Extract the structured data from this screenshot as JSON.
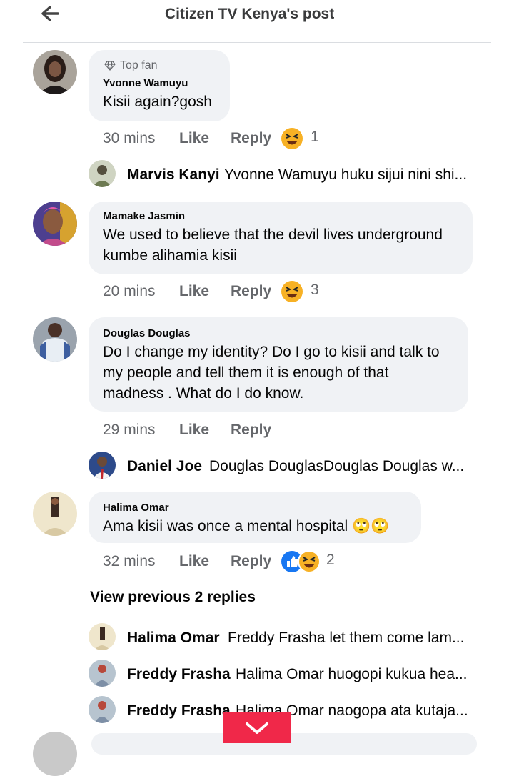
{
  "header": {
    "title": "Citizen TV Kenya's post"
  },
  "comments": [
    {
      "badge": "Top fan",
      "author": "Yvonne Wamuyu",
      "lines": [
        "Kisii again?gosh"
      ],
      "time": "30 mins",
      "like": "Like",
      "reply": "Reply",
      "reactions": [
        "haha-icon"
      ],
      "count": "1"
    },
    {
      "author": "Mamake Jasmin",
      "lines": [
        "We used to believe that the devil lives underground",
        "kumbe alihamia kisii"
      ],
      "time": "20 mins",
      "like": "Like",
      "reply": "Reply",
      "reactions": [
        "haha-icon"
      ],
      "count": "3"
    },
    {
      "author": "Douglas Douglas",
      "lines": [
        "Do I change my identity? Do I go to kisii and talk to",
        "my people and tell them it is enough of that",
        "madness . What do I do know."
      ],
      "time": "29 mins",
      "like": "Like",
      "reply": "Reply"
    },
    {
      "author": "Halima Omar",
      "lines": [
        "Ama kisii was once a mental hospital 🙄🙄"
      ],
      "time": "32 mins",
      "like": "Like",
      "reply": "Reply",
      "reactions": [
        "like-icon",
        "haha-icon"
      ],
      "count": "2"
    }
  ],
  "replies": [
    {
      "name": "Marvis Kanyi",
      "text": "Yvonne Wamuyu huku sijui nini shi..."
    },
    {
      "name": "Daniel Joe",
      "text": "Douglas DouglasDouglas Douglas w..."
    },
    {
      "name": "Halima Omar",
      "text": "Freddy Frasha let them come lam..."
    },
    {
      "name": "Freddy Frasha",
      "text": "Halima Omar huogopi kukua hea..."
    },
    {
      "name": "Freddy Frasha",
      "text": "Halima Omar naogopa ata kutaja..."
    }
  ],
  "view_previous": "View previous 2 replies",
  "colors": {
    "meta": "#65676b",
    "bubble": "#f0f2f5",
    "accent": "#f02849",
    "like_blue": "#1877f2"
  }
}
